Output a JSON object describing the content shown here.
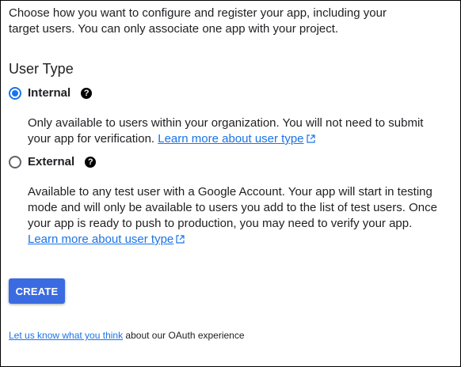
{
  "intro": {
    "line1": "Choose how you want to configure and register your app, including your",
    "line2": "target users. You can only associate one app with your project."
  },
  "user_type": {
    "heading": "User Type",
    "options": [
      {
        "label": "Internal",
        "checked": true,
        "description": "Only available to users within your organization. You will not need to submit your app for verification.",
        "link_text": "Learn more about user type"
      },
      {
        "label": "External",
        "checked": false,
        "description": "Available to any test user with a Google Account. Your app will start in testing mode and will only be available to users you add to the list of test users. Once your app is ready to push to production, you may need to verify your app.",
        "link_text": "Learn more about user type"
      }
    ],
    "help_glyph": "?"
  },
  "actions": {
    "create_label": "CREATE"
  },
  "footer": {
    "link_text": "Let us know what you think",
    "rest_text": " about our OAuth experience"
  },
  "colors": {
    "accent": "#1a73e8",
    "button": "#3b6be0"
  }
}
